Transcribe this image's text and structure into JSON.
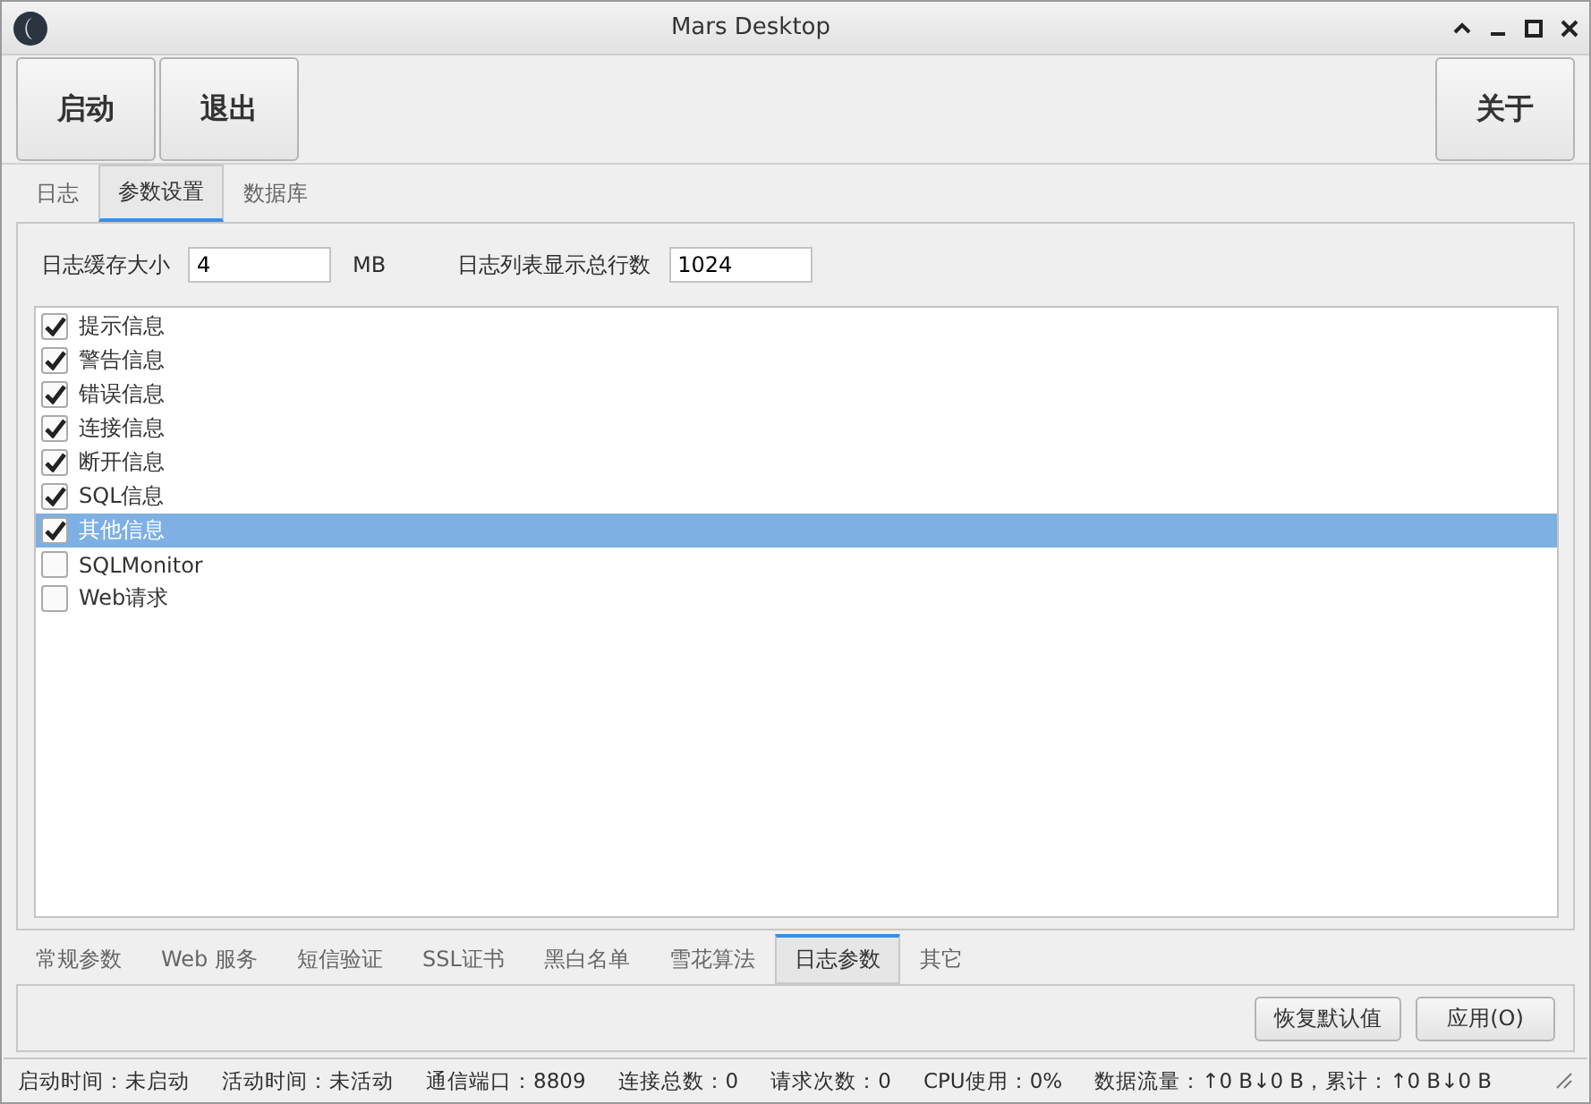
{
  "window": {
    "title": "Mars Desktop"
  },
  "toolbar": {
    "left_buttons": [
      "启动",
      "退出"
    ],
    "right_buttons": [
      "关于"
    ]
  },
  "tabs": [
    {
      "label": "日志",
      "selected": false
    },
    {
      "label": "参数设置",
      "selected": true
    },
    {
      "label": "数据库",
      "selected": false
    }
  ],
  "settings": {
    "cache_label": "日志缓存大小",
    "cache_value": "4",
    "cache_unit": "MB",
    "rows_label": "日志列表显示总行数",
    "rows_value": "1024"
  },
  "log_types": [
    {
      "label": "提示信息",
      "checked": true,
      "selected": false
    },
    {
      "label": "警告信息",
      "checked": true,
      "selected": false
    },
    {
      "label": "错误信息",
      "checked": true,
      "selected": false
    },
    {
      "label": "连接信息",
      "checked": true,
      "selected": false
    },
    {
      "label": "断开信息",
      "checked": true,
      "selected": false
    },
    {
      "label": "SQL信息",
      "checked": true,
      "selected": false
    },
    {
      "label": "其他信息",
      "checked": true,
      "selected": true
    },
    {
      "label": "SQLMonitor",
      "checked": false,
      "selected": false
    },
    {
      "label": "Web请求",
      "checked": false,
      "selected": false
    }
  ],
  "bottom_tabs": [
    {
      "label": "常规参数",
      "selected": false
    },
    {
      "label": "Web 服务",
      "selected": false
    },
    {
      "label": "短信验证",
      "selected": false
    },
    {
      "label": "SSL证书",
      "selected": false
    },
    {
      "label": "黑白名单",
      "selected": false
    },
    {
      "label": "雪花算法",
      "selected": false
    },
    {
      "label": "日志参数",
      "selected": true
    },
    {
      "label": "其它",
      "selected": false
    }
  ],
  "actions": [
    "恢复默认值",
    "应用(O)"
  ],
  "status_bar": [
    "启动时间：未启动",
    "活动时间：未活动",
    "通信端口：8809",
    "连接总数：0",
    "请求次数：0",
    "CPU使用：0%",
    "数据流量：↑0 B↓0 B，累计：↑0 B↓0 B"
  ]
}
